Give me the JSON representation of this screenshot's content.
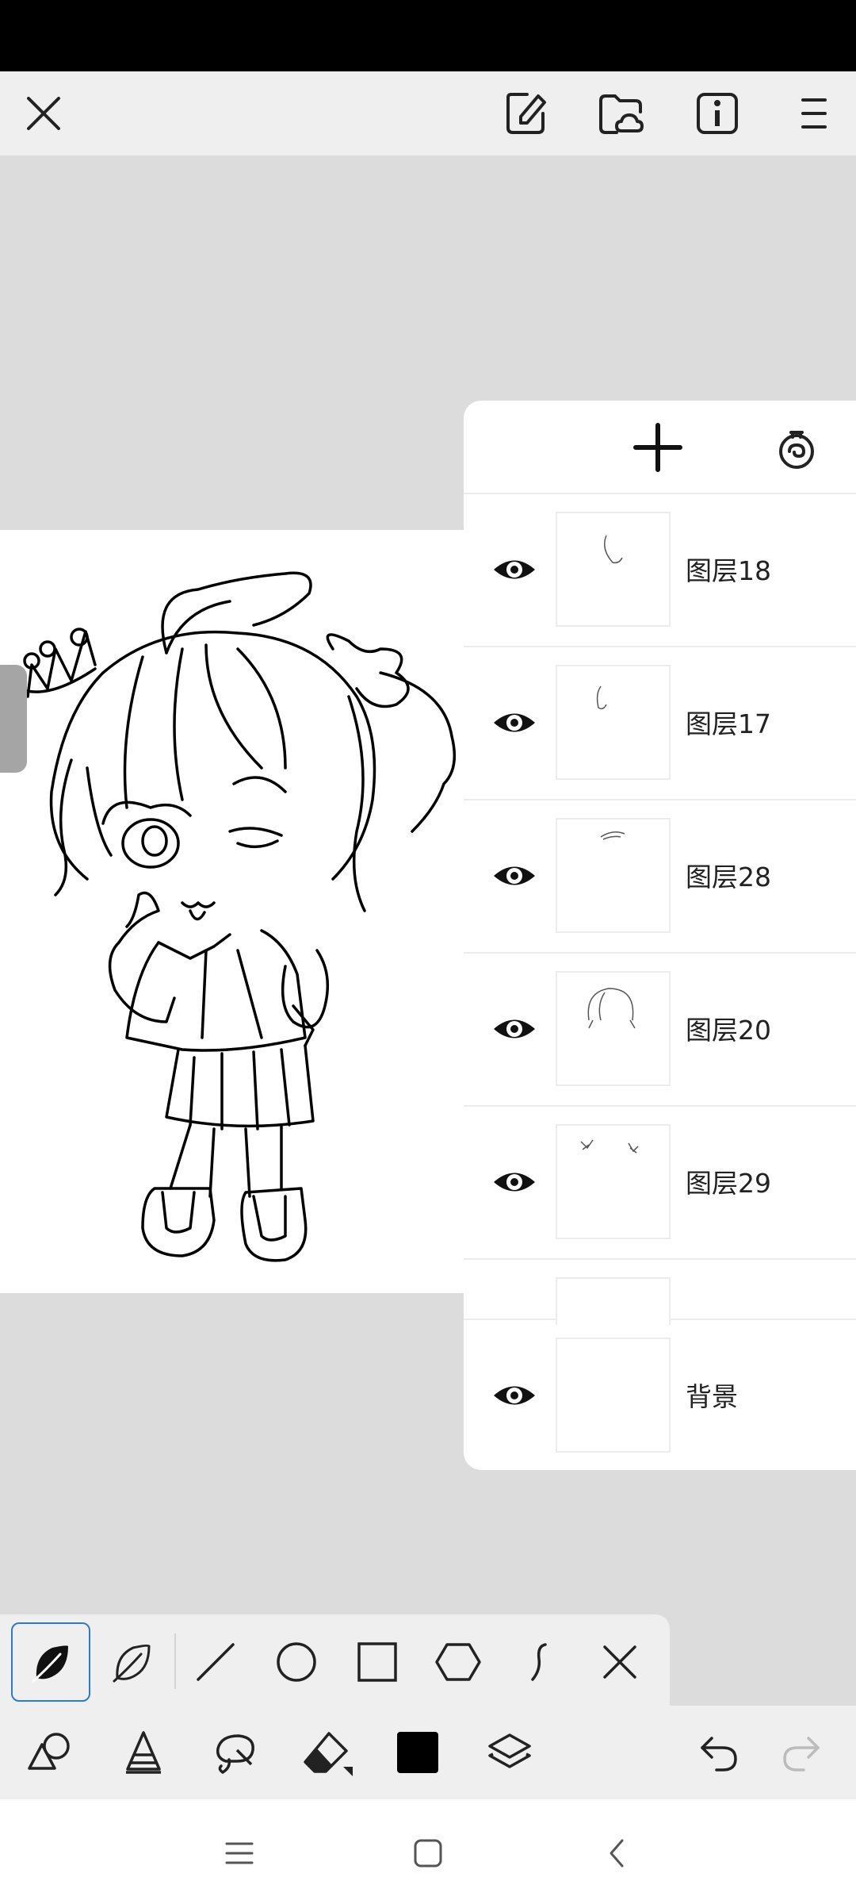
{
  "colors": {
    "accent": "#2a7bd4",
    "current_color": "#000000",
    "panel_bg": "#ffffff",
    "workspace_bg": "#dcdcdd"
  },
  "top_bar": {
    "icons": [
      "close-icon",
      "edit-document-icon",
      "cloud-folder-icon",
      "info-icon",
      "menu-icon"
    ]
  },
  "layers": {
    "header_icons": [
      "add-icon",
      "layer-settings-icon"
    ],
    "items": [
      {
        "name": "图层18",
        "visible": true
      },
      {
        "name": "图层17",
        "visible": true
      },
      {
        "name": "图层28",
        "visible": true
      },
      {
        "name": "图层20",
        "visible": true
      },
      {
        "name": "图层29",
        "visible": true
      },
      {
        "name": "背景",
        "visible": true
      }
    ]
  },
  "brush_bar": {
    "selected": "fill-stroke-brush",
    "items": [
      "fill-stroke-brush-icon",
      "outline-stroke-brush-icon",
      "line-icon",
      "circle-icon",
      "rectangle-icon",
      "hexagon-icon",
      "curve-icon",
      "cancel-icon"
    ]
  },
  "tool_bar": {
    "items": [
      "shapes-icon",
      "cone-icon",
      "lasso-icon",
      "eraser-icon",
      "color-swatch",
      "layers-icon",
      "undo-icon",
      "redo-icon"
    ]
  },
  "nav_bar": {
    "items": [
      "recents-icon",
      "home-icon",
      "back-icon"
    ]
  }
}
